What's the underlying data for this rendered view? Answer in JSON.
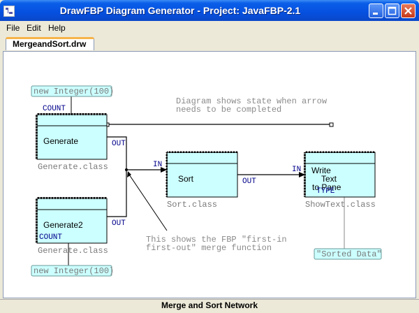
{
  "window": {
    "title": "DrawFBP Diagram Generator - Project: JavaFBP-2.1"
  },
  "menu": {
    "file": "File",
    "edit": "Edit",
    "help": "Help"
  },
  "tab": {
    "label": "MergeandSort.drw"
  },
  "status": {
    "text": "Merge and Sort Network"
  },
  "diagram": {
    "note_state": [
      "Diagram shows state when arrow",
      "needs to be completed"
    ],
    "note_merge": [
      "This shows the FBP \"first-in",
      "first-out\" merge function"
    ],
    "iip_generate1": "new Integer(100)",
    "iip_generate2": "new Integer(100)",
    "iip_write": "\"Sorted Data\"",
    "blocks": {
      "generate": {
        "label": "Generate",
        "class": "Generate.class"
      },
      "generate2": {
        "label": "Generate2",
        "class": "Generate.class"
      },
      "sort": {
        "label": "Sort",
        "class": "Sort.class"
      },
      "write": {
        "label_lines": [
          "Write",
          "Text",
          "to Pane"
        ],
        "class": "ShowText.class"
      }
    },
    "ports": {
      "count1": "COUNT",
      "out1": "OUT",
      "count2": "COUNT",
      "out2": "OUT",
      "sort_in": "IN",
      "sort_out": "OUT",
      "write_in": "IN",
      "write_type": "TYPE"
    }
  },
  "colors": {
    "block_fill": "#ccffff",
    "iip_fill": "#ccffff",
    "title_bar": "#0650e0",
    "note_text": "#8a8a8a",
    "port_text": "#00008b"
  }
}
